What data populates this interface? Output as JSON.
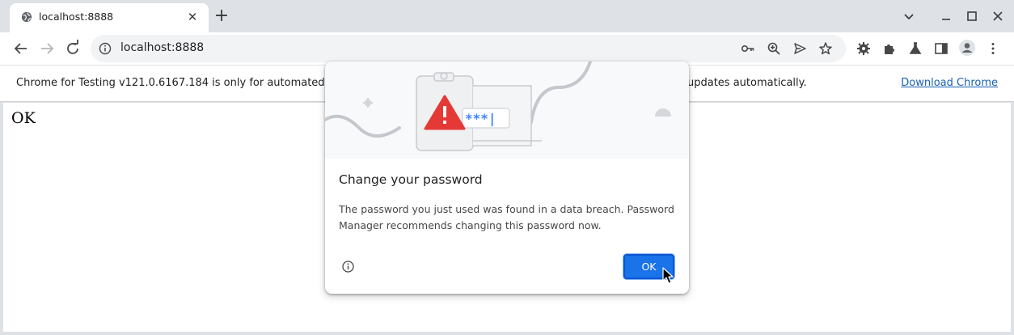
{
  "browser": {
    "tab_title": "localhost:8888",
    "new_tab_symbol": "+",
    "url": "localhost:8888"
  },
  "infobar": {
    "message_start": "Chrome for Testing v121.0.6167.184 is only for automated",
    "message_end": "updates automatically.",
    "link_label": "Download Chrome"
  },
  "page": {
    "text": "OK"
  },
  "dialog": {
    "title": "Change your password",
    "body": "The password you just used was found in a data breach. Password Manager recommends changing this password now.",
    "ok_label": "OK",
    "illustration_text": "***|"
  },
  "colors": {
    "accent": "#1a73e8",
    "warning": "#e53935"
  }
}
